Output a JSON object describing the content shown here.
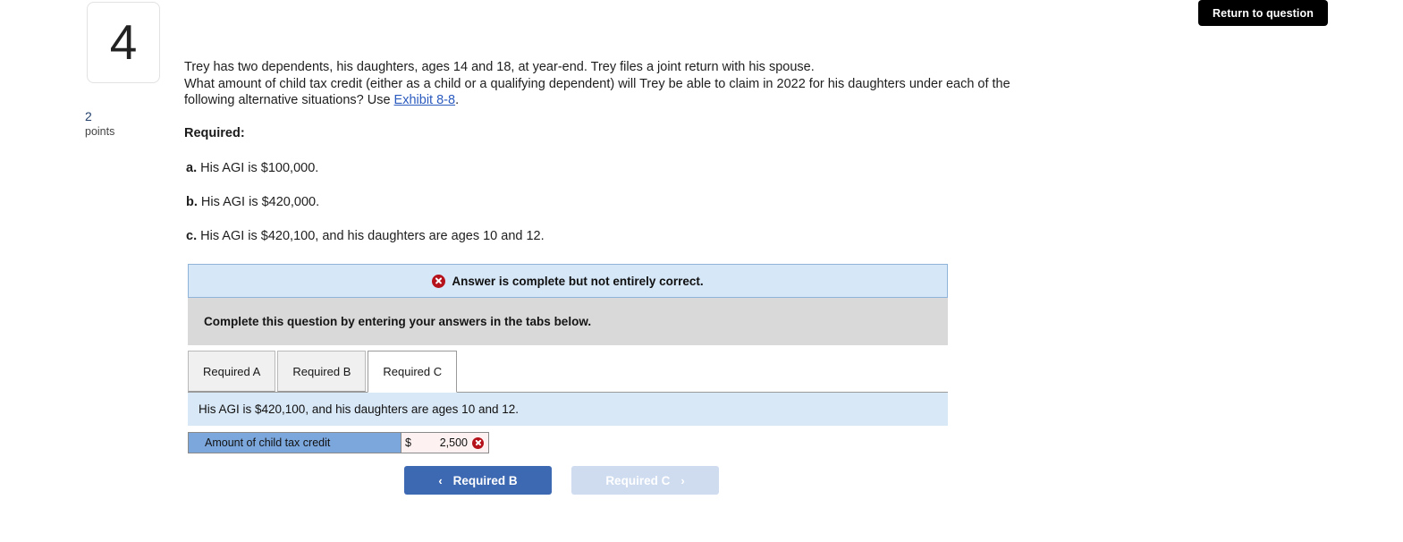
{
  "header": {
    "return_button_label": "Return to question"
  },
  "question": {
    "number": "4",
    "points_value": "2",
    "points_label": "points",
    "stem_line1": "Trey has two dependents, his daughters, ages 14 and 18, at year-end. Trey files a joint return with his spouse.",
    "stem_line2_before_link": "What amount of child tax credit (either as a child or a qualifying dependent) will Trey be able to claim in 2022 for his daughters under each of the following alternative situations? Use ",
    "exhibit_link_label": "Exhibit 8-8",
    "stem_line2_after_link": ".",
    "required_heading": "Required:",
    "requirements": [
      {
        "marker": "a.",
        "text": "His AGI is $100,000."
      },
      {
        "marker": "b.",
        "text": "His AGI is $420,000."
      },
      {
        "marker": "c.",
        "text": "His AGI is $420,100, and his daughters are ages 10 and 12."
      }
    ]
  },
  "answer_card": {
    "alert": {
      "icon": "error-circle-x-icon",
      "message": "Answer is complete but not entirely correct."
    },
    "instruction": "Complete this question by entering your answers in the tabs below.",
    "tabs": [
      {
        "label": "Required A",
        "active": false
      },
      {
        "label": "Required B",
        "active": false
      },
      {
        "label": "Required C",
        "active": true
      }
    ],
    "sub_header": "His AGI is $420,100, and his daughters are ages 10 and 12.",
    "entry_row": {
      "label": "Amount of child tax credit",
      "currency_symbol": "$",
      "value": "2,500",
      "status_icon": "error-circle-x-icon"
    }
  },
  "navigation": {
    "prev_label": "Required B",
    "prev_chevron": "‹",
    "next_label": "Required C",
    "next_chevron": "›"
  },
  "colors": {
    "accent_blue": "#3d68b2",
    "alert_bg": "#d6e7f8",
    "error_red": "#b5121b",
    "label_blue": "#7ba7dd",
    "input_error_bg": "#fdf1f1"
  }
}
